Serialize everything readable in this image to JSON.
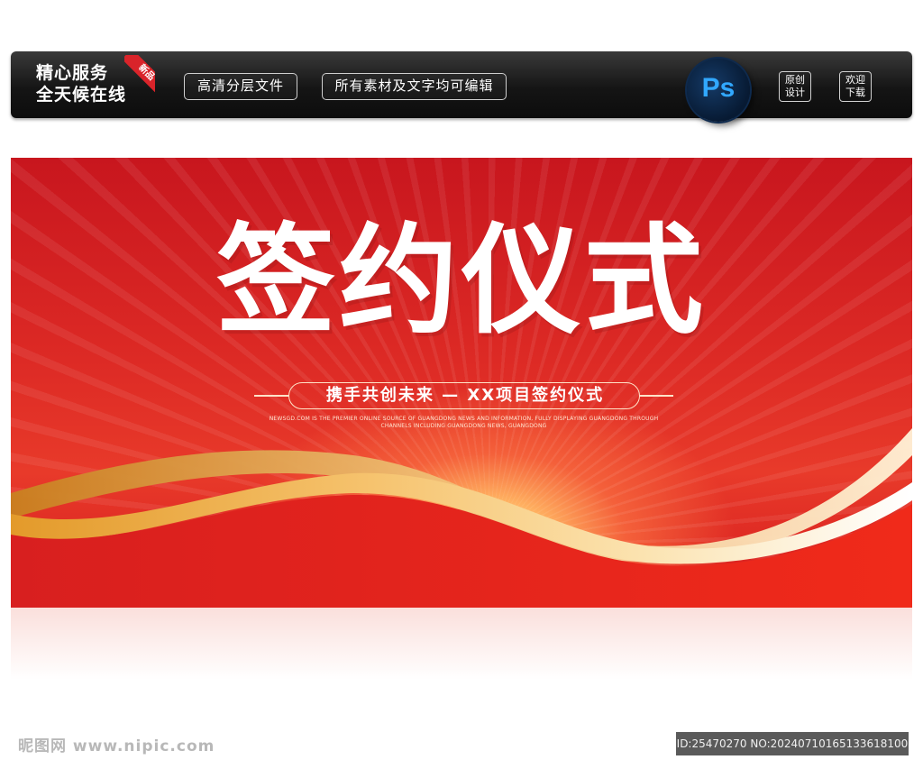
{
  "header": {
    "slogan_line1": "精心服务",
    "slogan_line2": "全天候在线",
    "ribbon_label": "新品",
    "pill1": "高清分层文件",
    "pill2": "所有素材及文字均可编辑",
    "ps_label": "Ps",
    "badge1": "原创\n设计",
    "badge2": "欢迎\n下载"
  },
  "banner": {
    "title": "签约仪式",
    "subtitle": "携手共创未来 — XX项目签约仪式",
    "english_line1": "NEWSGD.COM IS THE PREMIER ONLINE SOURCE OF GUANGDONG NEWS AND INFORMATION, FULLY DISPLAYING GUANGDONG THROUGH",
    "english_line2": "CHANNELS INCLUDING GUANGDONG NEWS, GUANGDONG"
  },
  "footer": {
    "watermark": "昵图网 www.nipic.com",
    "id_text": "ID:25470270 NO:20240710165133618100"
  },
  "colors": {
    "banner_red": "#dd2a25",
    "wave_gold": "#f2c27a",
    "ps_blue": "#31a8ff",
    "bar_dark": "#151515"
  }
}
